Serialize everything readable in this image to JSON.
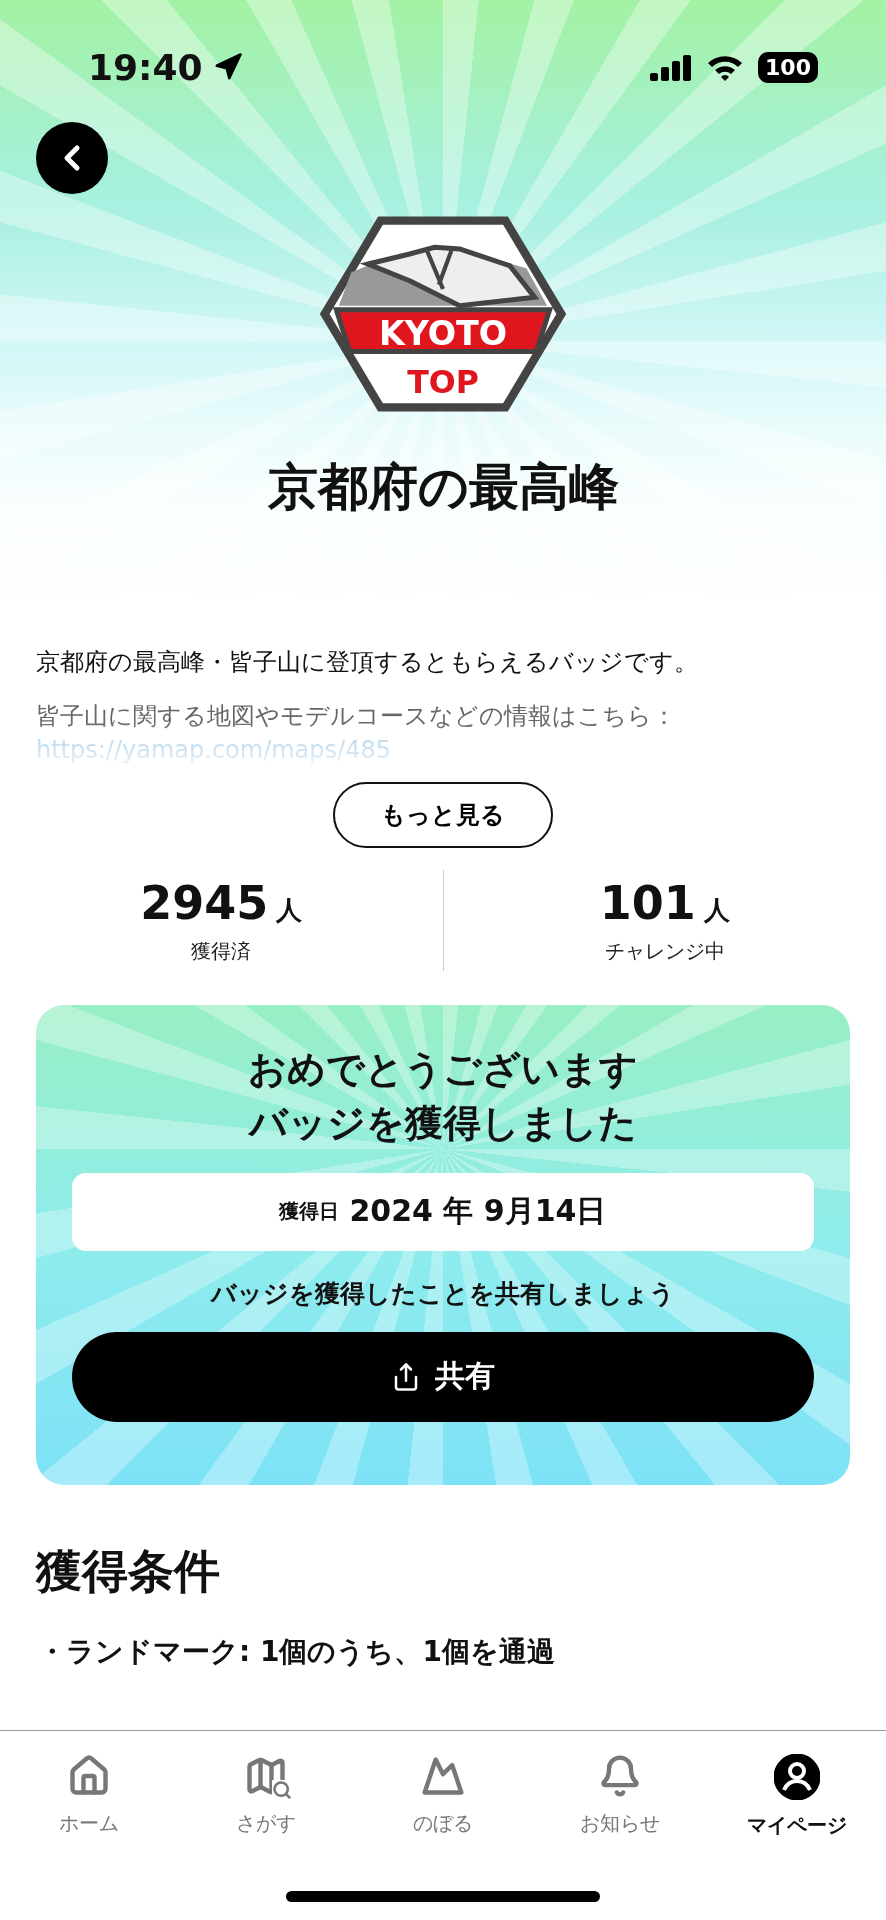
{
  "status_bar": {
    "time": "19:40",
    "battery": "100"
  },
  "badge": {
    "top_text": "KYOTO",
    "bottom_text": "TOP"
  },
  "title": "京都府の最高峰",
  "description": {
    "paragraphs": [
      "京都府の最高峰・皆子山に登頂するともらえるバッジです。",
      "皆子山に関する地図やモデルコースなどの情報はこちら："
    ],
    "link": "https://yamap.com/maps/485"
  },
  "more_button": "もっと見る",
  "stats": [
    {
      "value": "2945",
      "unit": "人",
      "label": "獲得済"
    },
    {
      "value": "101",
      "unit": "人",
      "label": "チャレンジ中"
    }
  ],
  "achievement": {
    "title_lines": [
      "おめでとうございます",
      "バッジを獲得しました"
    ],
    "date_label": "獲得日",
    "date": "2024 年 9月14日",
    "share_prompt": "バッジを獲得したことを共有しましょう",
    "share_button": "共有"
  },
  "conditions": {
    "heading": "獲得条件",
    "items": [
      "・ランドマーク: 1個のうち、1個を通過"
    ]
  },
  "tab_bar": [
    {
      "kind": "home",
      "label": "ホーム",
      "selected": false
    },
    {
      "kind": "search",
      "label": "さがす",
      "selected": false
    },
    {
      "kind": "climb",
      "label": "のぼる",
      "selected": false
    },
    {
      "kind": "notice",
      "label": "お知らせ",
      "selected": false
    },
    {
      "kind": "mypage",
      "label": "マイページ",
      "selected": true
    }
  ]
}
